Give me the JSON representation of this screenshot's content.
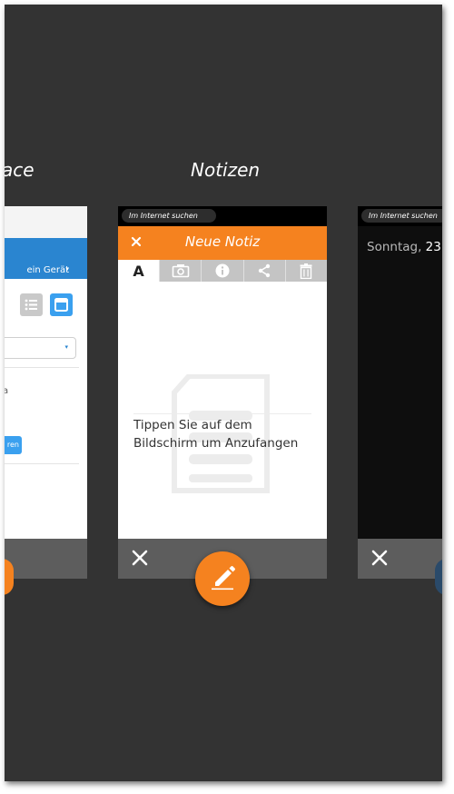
{
  "app_titles": {
    "left": "ace",
    "middle": "Notizen"
  },
  "left_card": {
    "device_dropdown": "ein Gerät",
    "dropdown_arrow": "▾",
    "text_fragment": "a",
    "button_fragment": "ren",
    "list_view_icon": "list-icon",
    "card_view_icon": "card-view-icon"
  },
  "notes_card": {
    "search_pill": "Im Internet suchen",
    "title": "Neue Notiz",
    "toolbar": {
      "text_label": "A",
      "camera": "camera-icon",
      "info": "info-icon",
      "share": "share-icon",
      "delete": "trash-icon"
    },
    "hint": "Tippen Sie auf dem Bildschirm um Anzufangen",
    "hint_line1": "Tippen Sie auf dem",
    "hint_line2": "Bildschirm um Anzufangen"
  },
  "right_card": {
    "search_pill": "Im Internet suchen",
    "day": "Sonntag,",
    "date_number": "23"
  },
  "colors": {
    "accent": "#f5821f",
    "background": "#333333",
    "card_footer": "#5d5d5d",
    "blue": "#2a85d0"
  },
  "fab_icon": "pencil-icon"
}
